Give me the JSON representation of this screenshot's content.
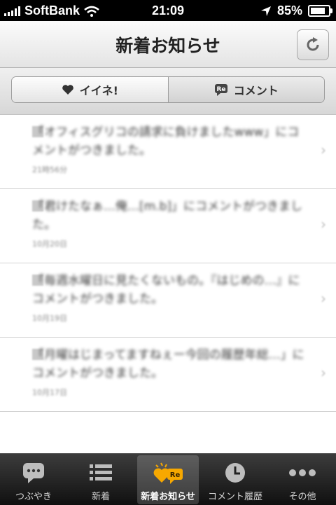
{
  "status_bar": {
    "carrier": "SoftBank",
    "time": "21:09",
    "battery": "85%"
  },
  "nav": {
    "title": "新着お知らせ"
  },
  "segments": [
    {
      "label": "イイネ!",
      "active": true
    },
    {
      "label": "コメント",
      "active": false
    }
  ],
  "notifications": [
    {
      "text": "「オフィスグリコの請求に負けましたwww」にコメントがつきました。",
      "date": "21時56分"
    },
    {
      "text": "「君けたなぁ…俺…[m.b]」にコメントがつきました。",
      "date": "10月20日"
    },
    {
      "text": "「毎週水曜日に見たくないもの。『はじめの…』にコメントがつきました。",
      "date": "10月19日"
    },
    {
      "text": "「月曜はじまってますねぇー今回の履歴年総…」にコメントがつきました。",
      "date": "10月17日"
    }
  ],
  "tabs": [
    {
      "label": "つぶやき",
      "icon": "chat-bubble-icon"
    },
    {
      "label": "新着",
      "icon": "list-icon"
    },
    {
      "label": "新着お知らせ",
      "icon": "heart-re-icon",
      "selected": true
    },
    {
      "label": "コメント履歴",
      "icon": "clock-icon"
    },
    {
      "label": "その他",
      "icon": "more-dots-icon"
    }
  ],
  "colors": {
    "accent": "#f7a800",
    "tabbar": "#1a1a1a"
  }
}
